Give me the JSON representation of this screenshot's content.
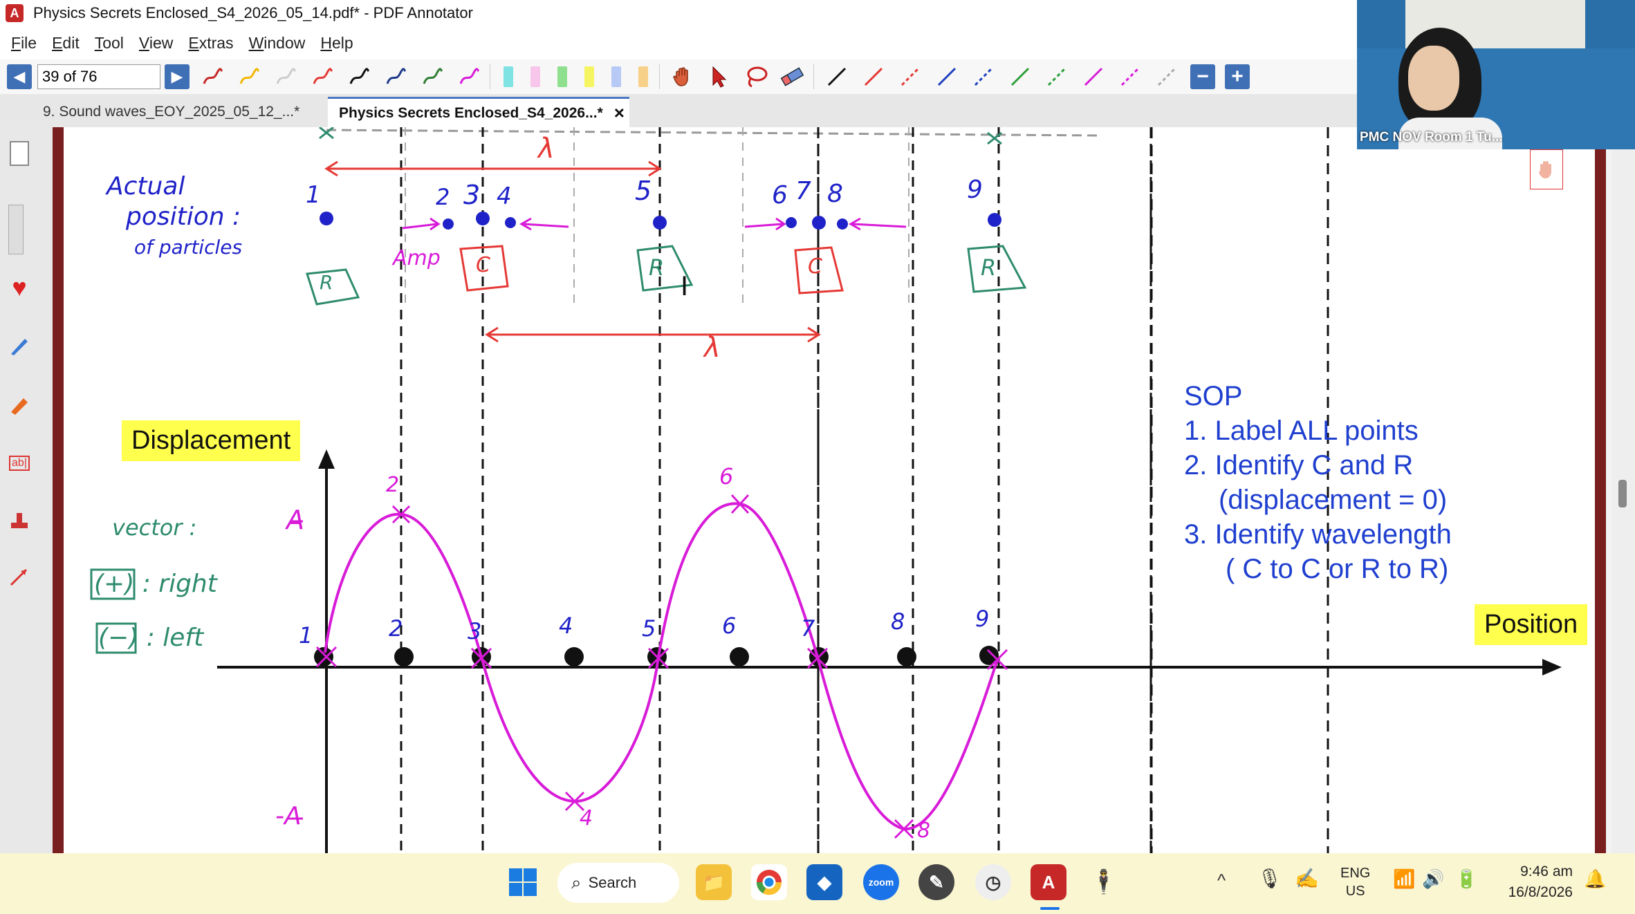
{
  "window": {
    "title": "Physics Secrets Enclosed_S4_2026_05_14.pdf* - PDF Annotator"
  },
  "menu": {
    "items": [
      {
        "first": "F",
        "rest": "ile"
      },
      {
        "first": "E",
        "rest": "dit"
      },
      {
        "first": "T",
        "rest": "ool"
      },
      {
        "first": "V",
        "rest": "iew"
      },
      {
        "first": "E",
        "rest": "xtras"
      },
      {
        "first": "W",
        "rest": "indow"
      },
      {
        "first": "H",
        "rest": "elp"
      }
    ]
  },
  "toolbar": {
    "page_value": "39 of 76",
    "pen_colors": [
      "#c62828",
      "#f2b705",
      "#cccccc",
      "#e53935",
      "#111111",
      "#1e3a8a",
      "#2e7d32",
      "#d81bd8"
    ],
    "highlighter_colors": [
      "#7fe3e3",
      "#f7c6ea",
      "#8ee08e",
      "#f5f562",
      "#b7c9f5",
      "#f7d08a"
    ],
    "line_colors": [
      "#111111",
      "#e53935",
      "#e53935",
      "#1f3fbf",
      "#1f3fbf",
      "#2e9e3a",
      "#2e9e3a",
      "#d81bd8",
      "#d81bd8",
      "#aaaaaa"
    ]
  },
  "tabs": [
    {
      "label": "9. Sound waves_EOY_2025_05_12_...*"
    },
    {
      "label": "Physics Secrets Enclosed_S4_2026...*",
      "close": "×"
    }
  ],
  "webcam": {
    "label": "PMC NOV Room 1 Tu..."
  },
  "slide": {
    "displacement_label": "Displacement",
    "position_label": "Position",
    "sop_lines": [
      "SOP",
      "1. Label ALL points",
      "2. Identify C and R",
      "(displacement = 0)",
      "3. Identify wavelength",
      "( C to C or R to R)"
    ]
  },
  "annotations": {
    "actual_position": [
      "Actual",
      "position :",
      "of particles"
    ],
    "amp": "Amp",
    "lambda": "λ",
    "top_numbers": [
      "1",
      "2",
      "3",
      "4",
      "5",
      "6",
      "7",
      "8",
      "9"
    ],
    "boxes": [
      "R",
      "C",
      "R",
      "C",
      "R"
    ],
    "vector": "vector :",
    "plus_right": "(+) : right",
    "minus_left": "(−) : left",
    "axis_A": "A",
    "axis_negA": "-A",
    "axis_numbers": [
      "1",
      "2",
      "3",
      "4",
      "5",
      "6",
      "7",
      "8",
      "9"
    ],
    "curve_peak_labels": [
      "2",
      "6",
      "4",
      "8"
    ]
  },
  "taskbar": {
    "search_label": "Search",
    "lang_top": "ENG",
    "lang_bottom": "US",
    "time": "9:46 am",
    "date": "16/8/2026"
  }
}
